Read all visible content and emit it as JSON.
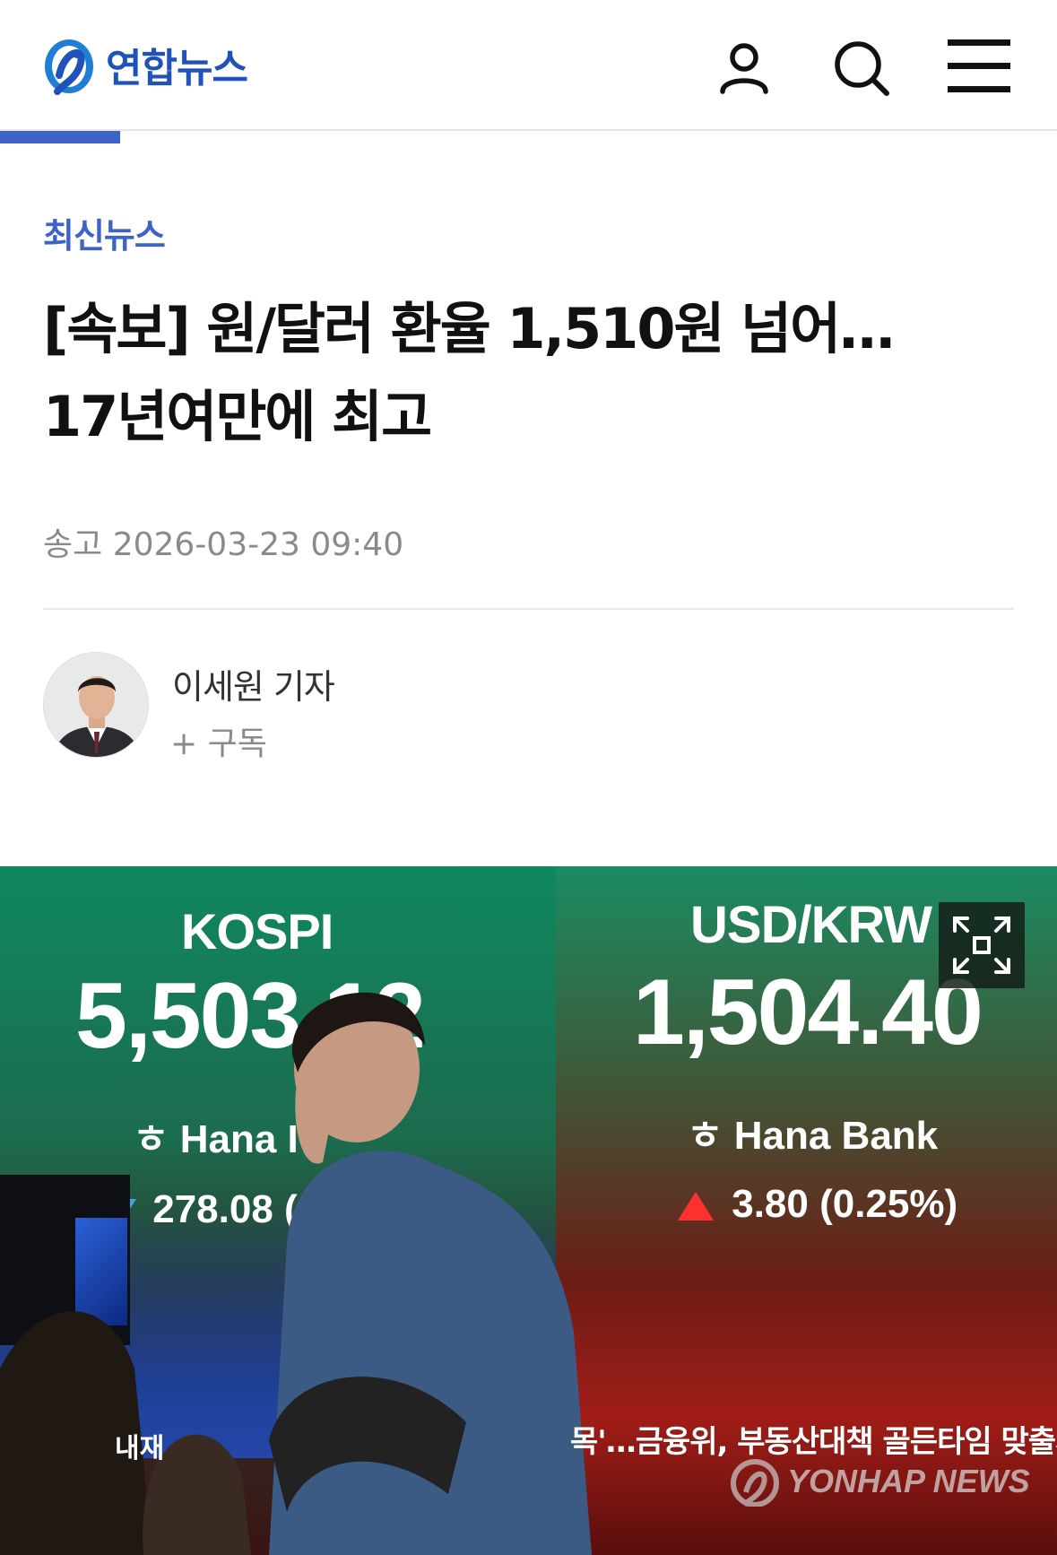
{
  "header": {
    "logo_text": "연합뉴스",
    "icons": [
      "user-icon",
      "search-icon",
      "menu-icon"
    ]
  },
  "article": {
    "category": "최신뉴스",
    "headline_line1": "[속보] 원/달러 환율 1,510원 넘어…",
    "headline_line2": "17년여만에 최고",
    "sent_label": "송고",
    "sent_datetime": "2026-03-23 09:40",
    "reporter_name": "이세원 기자",
    "subscribe_label": "+ 구독"
  },
  "photo": {
    "kospi_label": "KOSPI",
    "kospi_value": "5,503.12",
    "kospi_bank": "Hana I",
    "kospi_change": "278.08 (4",
    "usd_label": "USD/KRW",
    "usd_value": "1,504.40",
    "usd_bank": "Hana Bank",
    "usd_change": "3.80 (0.25%)",
    "ticker_left": "내재",
    "ticker_right": "목'…금융위, 부동산대책 골든타임 맞출까",
    "watermark": "YONHAP NEWS"
  },
  "colors": {
    "brand_blue": "#1f53b9",
    "category_blue": "#3d63c9",
    "meta_gray": "#8a8a8a"
  }
}
